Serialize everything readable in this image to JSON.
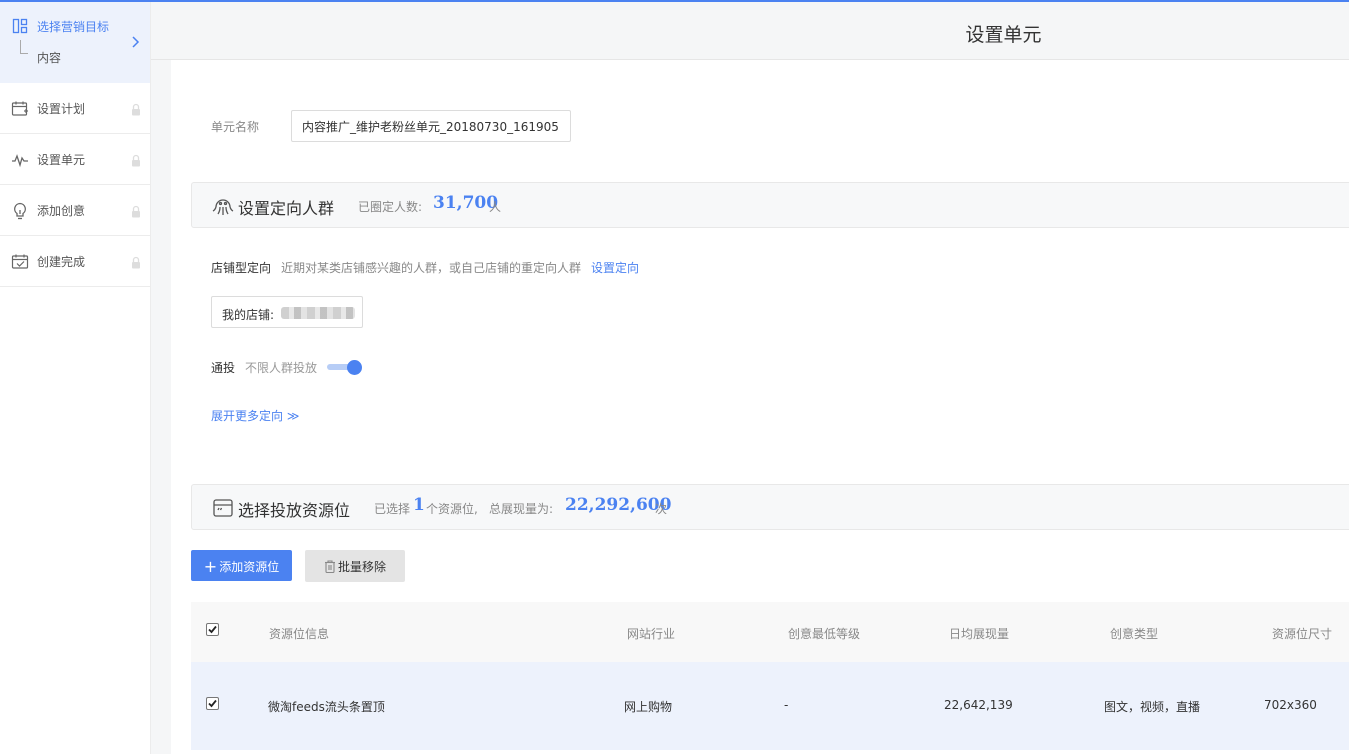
{
  "sidebar": {
    "active": {
      "title": "选择营销目标",
      "sub": "内容"
    },
    "items": [
      {
        "label": "设置计划",
        "icon": "calendar-add-icon"
      },
      {
        "label": "设置单元",
        "icon": "pulse-icon"
      },
      {
        "label": "添加创意",
        "icon": "lightbulb-icon"
      },
      {
        "label": "创建完成",
        "icon": "calendar-check-icon"
      }
    ]
  },
  "header": {
    "title": "设置单元"
  },
  "unit": {
    "label": "单元名称",
    "value": "内容推广_维护老粉丝单元_20180730_161905"
  },
  "audience": {
    "title": "设置定向人群",
    "count_prefix": "已圈定人数:",
    "count": "31,700",
    "count_unit": "人",
    "shop_targeting_label": "店铺型定向",
    "shop_targeting_desc": "近期对某类店铺感兴趣的人群，或自己店铺的重定向人群",
    "shop_targeting_link": "设置定向",
    "my_shop_label": "我的店铺:",
    "general_label": "通投",
    "general_desc": "不限人群投放",
    "general_enabled": true,
    "expand_link": "展开更多定向 ≫"
  },
  "resources": {
    "title": "选择投放资源位",
    "selected_prefix": "已选择",
    "selected_count": "1",
    "selected_suffix": "个资源位,",
    "total_prefix": "总展现量为:",
    "total": "22,292,600",
    "total_unit": "次",
    "add_button": "添加资源位",
    "remove_button": "批量移除",
    "columns": [
      "资源位信息",
      "网站行业",
      "创意最低等级",
      "日均展现量",
      "创意类型",
      "资源位尺寸"
    ],
    "rows": [
      {
        "name": "微淘feeds流头条置顶",
        "industry": "网上购物",
        "level": "-",
        "daily": "22,642,139",
        "types": "图文，视频，直播",
        "size": "702x360",
        "checked": true
      }
    ],
    "all_checked": true
  },
  "colors": {
    "accent": "#4b82f1",
    "active_bg": "#edf2fc"
  }
}
